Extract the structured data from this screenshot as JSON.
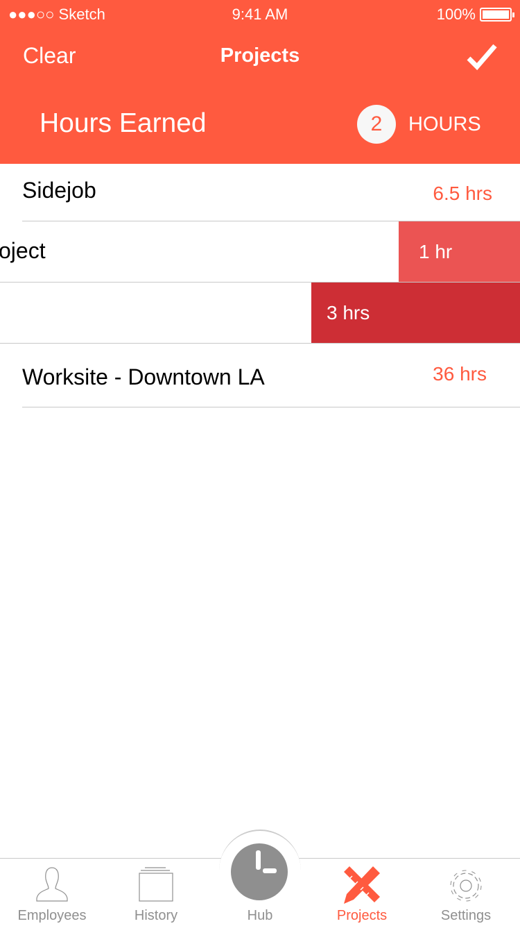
{
  "status_bar": {
    "carrier": "●●●○○ Sketch",
    "time": "9:41 AM",
    "battery": "100%"
  },
  "nav": {
    "clear": "Clear",
    "title": "Projects"
  },
  "summary": {
    "label": "Hours Earned",
    "count": "2",
    "unit": "HOURS"
  },
  "rows": [
    {
      "name": "Sidejob",
      "value": "6.5 hrs"
    },
    {
      "name": "oject",
      "action": "1 hr"
    },
    {
      "name": "",
      "action": "3 hrs"
    },
    {
      "name": "Worksite - Downtown LA",
      "value": "36 hrs"
    }
  ],
  "tabs": [
    {
      "label": "Employees"
    },
    {
      "label": "History"
    },
    {
      "label": "Hub"
    },
    {
      "label": "Projects"
    },
    {
      "label": "Settings"
    }
  ],
  "colors": {
    "accent": "#FF5A3F",
    "action1": "#EB5453",
    "action2": "#CD2E35"
  }
}
